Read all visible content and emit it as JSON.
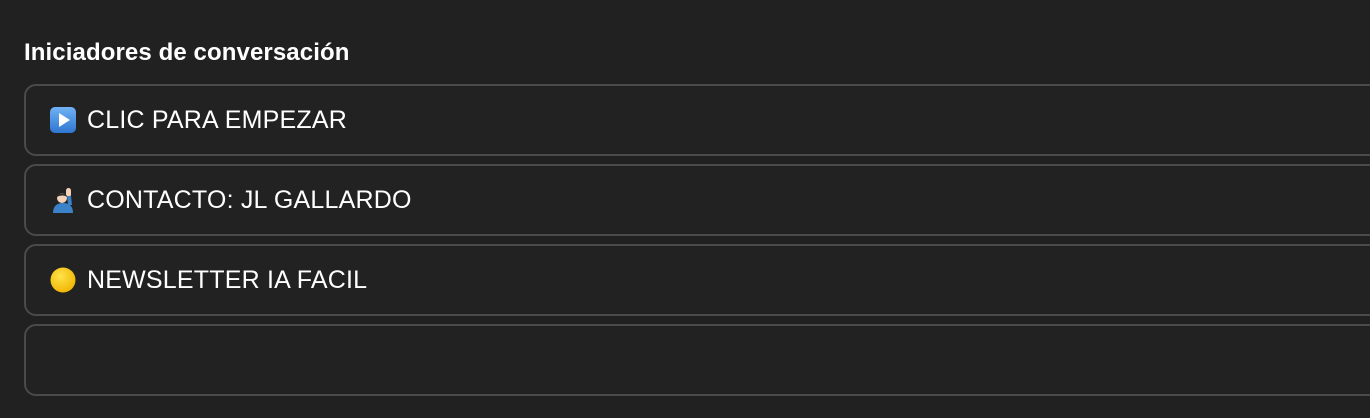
{
  "section": {
    "title": "Iniciadores de conversación"
  },
  "starters": [
    {
      "icon": "play-button-icon",
      "label": "CLIC PARA EMPEZAR"
    },
    {
      "icon": "person-raising-hand-icon",
      "label": "CONTACTO: JL GALLARDO"
    },
    {
      "icon": "yellow-circle-icon",
      "label": "NEWSLETTER IA FACIL"
    },
    {
      "icon": "",
      "label": ""
    }
  ],
  "colors": {
    "background": "#212121",
    "border": "#4a4a4a",
    "play_icon_blue": "#4a90d9",
    "yellow_circle": "#f7c600"
  }
}
